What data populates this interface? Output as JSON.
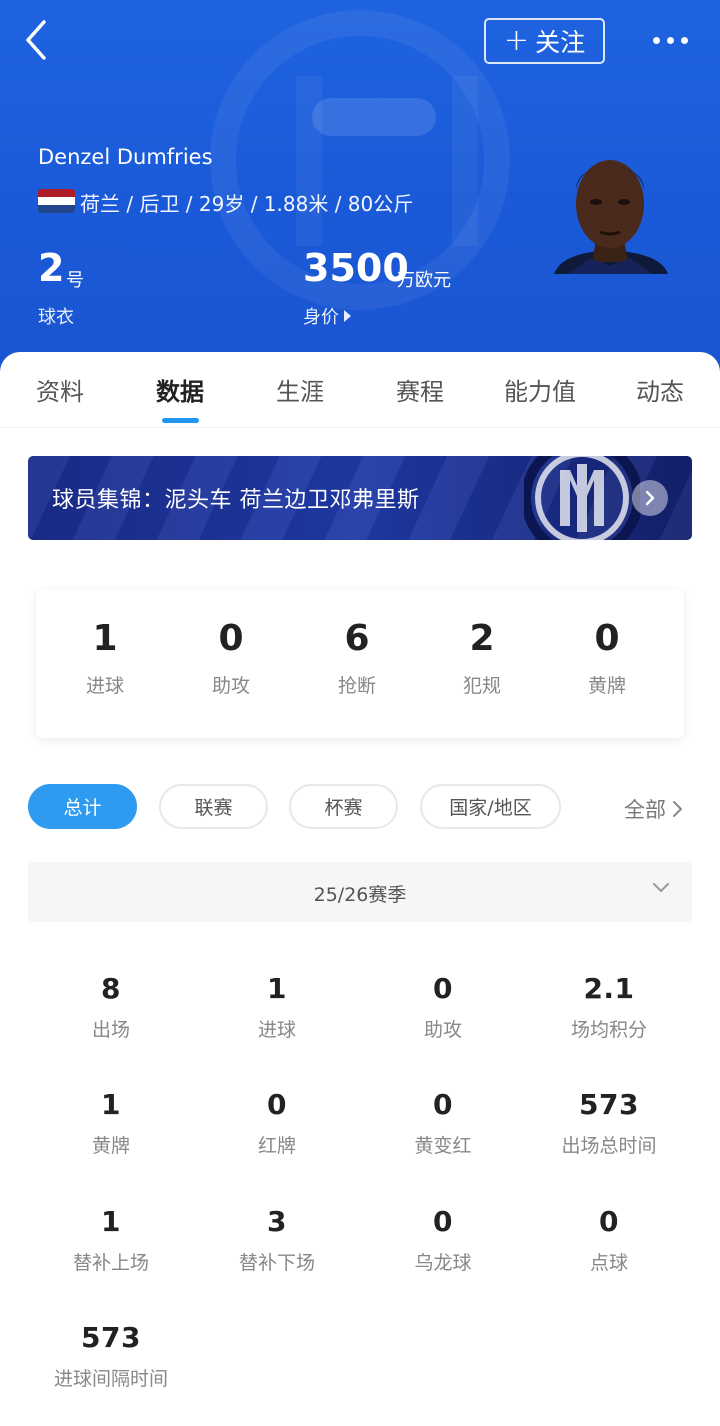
{
  "header": {
    "follow_label": "关注",
    "player_name": "Denzel Dumfries",
    "info": "荷兰 / 后卫 / 29岁 / 1.88米 / 80公斤",
    "jersey": {
      "number": "2",
      "unit": "号",
      "label": "球衣"
    },
    "market_value": {
      "amount": "3500",
      "unit": "万欧元",
      "label": "身价"
    }
  },
  "tabs": [
    {
      "label": "资料"
    },
    {
      "label": "数据"
    },
    {
      "label": "生涯"
    },
    {
      "label": "赛程"
    },
    {
      "label": "能力值"
    },
    {
      "label": "动态"
    }
  ],
  "active_tab": "数据",
  "banner": {
    "text": "球员集锦：泥头车 荷兰边卫邓弗里斯"
  },
  "summary": [
    {
      "value": "1",
      "label": "进球"
    },
    {
      "value": "0",
      "label": "助攻"
    },
    {
      "value": "6",
      "label": "抢断"
    },
    {
      "value": "2",
      "label": "犯规"
    },
    {
      "value": "0",
      "label": "黄牌"
    }
  ],
  "filters": [
    {
      "label": "总计",
      "active": true
    },
    {
      "label": "联赛",
      "active": false
    },
    {
      "label": "杯赛",
      "active": false
    },
    {
      "label": "国家/地区",
      "active": false
    }
  ],
  "filters_all": "全部",
  "season": "25/26赛季",
  "stats": [
    {
      "value": "8",
      "label": "出场"
    },
    {
      "value": "1",
      "label": "进球"
    },
    {
      "value": "0",
      "label": "助攻"
    },
    {
      "value": "2.1",
      "label": "场均积分"
    },
    {
      "value": "1",
      "label": "黄牌"
    },
    {
      "value": "0",
      "label": "红牌"
    },
    {
      "value": "0",
      "label": "黄变红"
    },
    {
      "value": "573",
      "label": "出场总时间"
    },
    {
      "value": "1",
      "label": "替补上场"
    },
    {
      "value": "3",
      "label": "替补下场"
    },
    {
      "value": "0",
      "label": "乌龙球"
    },
    {
      "value": "0",
      "label": "点球"
    },
    {
      "value": "573",
      "label": "进球间隔时间"
    }
  ],
  "colors": {
    "header_blue": "#1a5ad8",
    "accent": "#2e9bf0",
    "flag": [
      "#ae1c28",
      "#ffffff",
      "#21468b"
    ]
  },
  "icons": [
    "back-icon",
    "plus-icon",
    "more-icon",
    "chevron-right-icon",
    "chevron-down-icon",
    "inter-logo-icon"
  ]
}
